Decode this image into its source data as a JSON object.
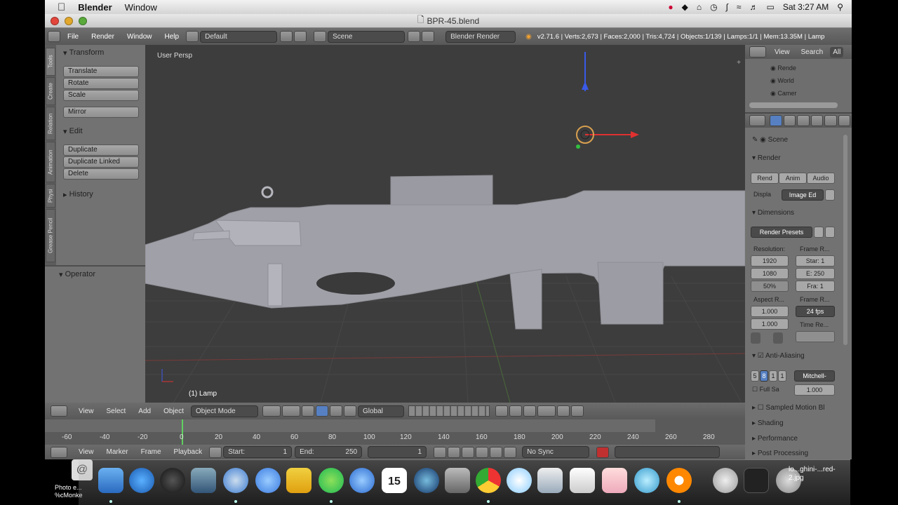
{
  "mac_menu": {
    "app": "Blender",
    "menu": "Window",
    "clock": "Sat 3:27 AM"
  },
  "window": {
    "title": "BPR-45.blend"
  },
  "info_header": {
    "menus": [
      "File",
      "Render",
      "Window",
      "Help"
    ],
    "screen_layout": "Default",
    "scene": "Scene",
    "render_engine": "Blender Render",
    "stats": "v2.71.6 | Verts:2,673 | Faces:2,000 | Tris:4,724 | Objects:1/139 | Lamps:1/1 | Mem:13.35M | Lamp"
  },
  "tool_tabs": [
    "Tools",
    "Create",
    "Relation",
    "Animation",
    "Physi",
    "Grease Pencil"
  ],
  "toolshelf": {
    "transform_title": "Transform",
    "transform_buttons": [
      "Translate",
      "Rotate",
      "Scale"
    ],
    "mirror": "Mirror",
    "edit_title": "Edit",
    "edit_buttons": [
      "Duplicate",
      "Duplicate Linked",
      "Delete"
    ],
    "history_title": "History",
    "operator_title": "Operator"
  },
  "viewport": {
    "label": "User Persp",
    "object": "(1) Lamp"
  },
  "view3d_header": {
    "menus": [
      "View",
      "Select",
      "Add",
      "Object"
    ],
    "mode": "Object Mode",
    "orientation": "Global"
  },
  "timeline": {
    "ticks": [
      "-60",
      "-40",
      "-20",
      "0",
      "20",
      "40",
      "60",
      "80",
      "100",
      "120",
      "140",
      "160",
      "180",
      "200",
      "220",
      "240",
      "260",
      "280"
    ],
    "menus": [
      "View",
      "Marker",
      "Frame",
      "Playback"
    ],
    "start_label": "Start:",
    "start_value": "1",
    "end_label": "End:",
    "end_value": "250",
    "current": "1",
    "sync": "No Sync"
  },
  "outliner": {
    "menus": [
      "View",
      "Search",
      "All"
    ],
    "items": [
      "Rende",
      "World",
      "Camer"
    ]
  },
  "properties": {
    "context": "Scene",
    "render_title": "Render",
    "render_buttons": [
      "Rend",
      "Anim",
      "Audio"
    ],
    "display_label": "Displa",
    "display_value": "Image Ed",
    "dimensions_title": "Dimensions",
    "render_presets": "Render Presets",
    "resolution_label": "Resolution:",
    "frame_range_label": "Frame R...",
    "res_x": "1920",
    "res_y": "1080",
    "res_pct": "50%",
    "frame_start": "Star: 1",
    "frame_end": "E: 250",
    "frame_step": "Fra: 1",
    "aspect_label": "Aspect R...",
    "frame_rate_label": "Frame R...",
    "aspect_x": "1.000",
    "aspect_y": "1.000",
    "fps": "24 fps",
    "time_remap_label": "Time Re...",
    "aa_title": "Anti-Aliasing",
    "aa_samples": [
      "5",
      "8",
      "1",
      "1"
    ],
    "aa_filter": "Mitchell-",
    "full_sample": "Full Sa",
    "aa_size": "1.000",
    "collapsed": [
      "Sampled Motion Bl",
      "Shading",
      "Performance",
      "Post Processing"
    ]
  },
  "desktop": {
    "left_label": "Photo e... %cMonke",
    "right_label": "lo...ghini-...red-2.jpg",
    "calendar_day": "15"
  }
}
